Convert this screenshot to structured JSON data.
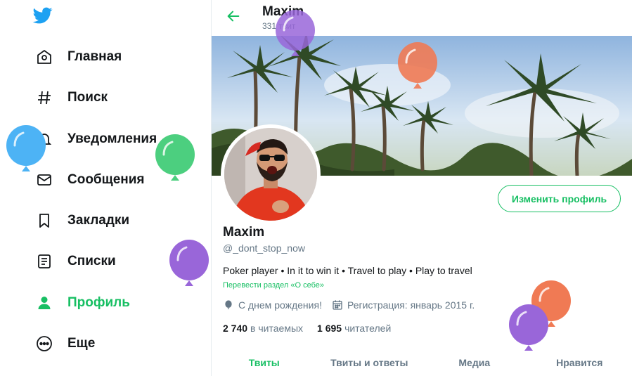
{
  "sidebar": {
    "items": [
      {
        "label": "Главная",
        "icon": "home-icon"
      },
      {
        "label": "Поиск",
        "icon": "hashtag-icon"
      },
      {
        "label": "Уведомления",
        "icon": "bell-icon"
      },
      {
        "label": "Сообщения",
        "icon": "envelope-icon"
      },
      {
        "label": "Закладки",
        "icon": "bookmark-icon"
      },
      {
        "label": "Списки",
        "icon": "list-icon"
      },
      {
        "label": "Профиль",
        "icon": "person-icon",
        "active": true
      },
      {
        "label": "Еще",
        "icon": "more-icon"
      }
    ]
  },
  "header": {
    "name": "Maxim",
    "tweet_count": "331 твит"
  },
  "profile": {
    "edit_button": "Изменить профиль",
    "name": "Maxim",
    "handle": "@_dont_stop_now",
    "bio": "Poker player • In it to win it • Travel to play • Play to travel",
    "translate_link": "Перевести раздел «О себе»",
    "birthday": "С днем рождения!",
    "joined": "Регистрация: январь 2015 г.",
    "following_count": "2 740",
    "following_label": "в читаемых",
    "followers_count": "1 695",
    "followers_label": "читателей"
  },
  "tabs": [
    {
      "label": "Твиты",
      "active": true
    },
    {
      "label": "Твиты и ответы"
    },
    {
      "label": "Медиа"
    },
    {
      "label": "Нравится"
    }
  ],
  "colors": {
    "accent": "#17bf63",
    "twitter_blue": "#1da1f2",
    "text": "#14171a",
    "secondary": "#657786",
    "balloon_blue": "#4db3f5",
    "balloon_green": "#4ccf7f",
    "balloon_purple": "#9966d9",
    "balloon_orange": "#f07a54"
  }
}
